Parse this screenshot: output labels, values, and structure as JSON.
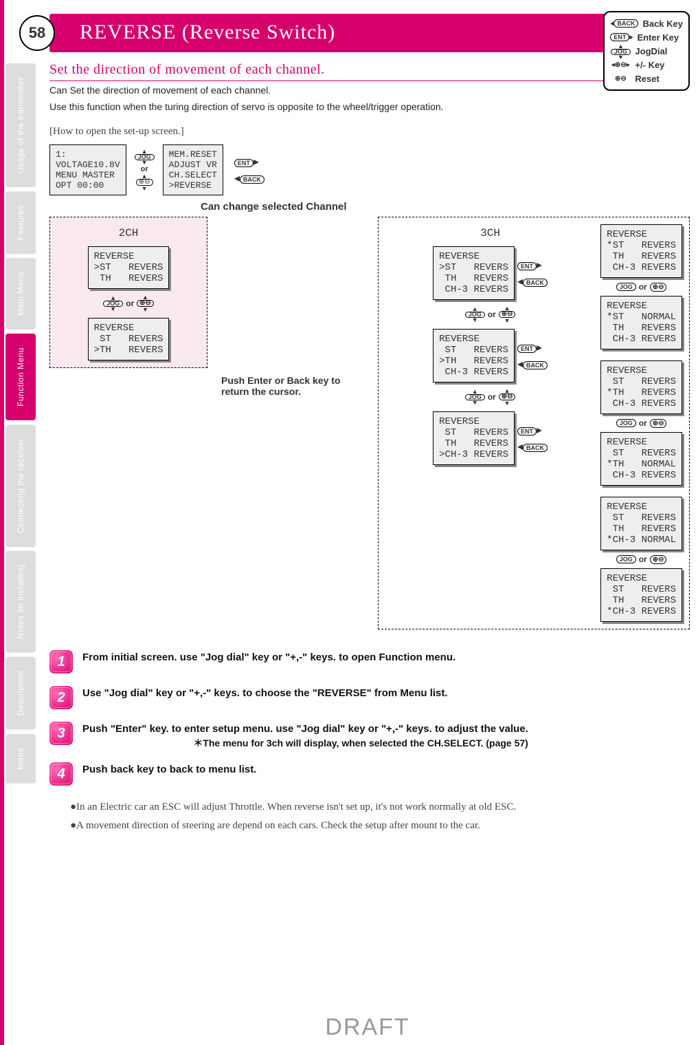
{
  "page_number": "58",
  "title": "REVERSE (Reverse Switch)",
  "subtitle": "Set the direction of movement of each channel.",
  "intro_lines": [
    "Can Set the direction of movement of each channel.",
    "Use this function when the turing direction of servo is opposite to the wheel/trigger operation."
  ],
  "howto_heading": "[How to open the set-up screen.]",
  "legend": {
    "back": "Back Key",
    "enter": "Enter Key",
    "jog": "JogDial",
    "plusminus": "+/- Key",
    "reset": "Reset"
  },
  "tabs": [
    {
      "label": "Usage of the\ntransmitter",
      "active": false
    },
    {
      "label": "Features",
      "active": false
    },
    {
      "label": "Main Menu",
      "active": false
    },
    {
      "label": "Function Menu",
      "active": true
    },
    {
      "label": "Connecting\nthe receiver",
      "active": false
    },
    {
      "label": "Notes on\ninstalling",
      "active": false
    },
    {
      "label": "Description",
      "active": false
    },
    {
      "label": "Index",
      "active": false
    }
  ],
  "lcd_initial": "1:\nVOLTAGE10.8V\nMENU MASTER\nOPT 00:00",
  "lcd_menu": "MEM.RESET\nADJUST VR\nCH.SELECT\n>REVERSE",
  "or_label": "or",
  "jog_label": "JOG",
  "ent_label": "ENT",
  "back_label": "BACK",
  "change_channel_label": "Can change selected Channel",
  "two_ch": {
    "title": "2CH",
    "screen_a": "REVERSE\n>ST   REVERS\n TH   REVERS",
    "screen_b": "REVERSE\n ST   REVERS\n>TH   REVERS",
    "hint": "Push Enter or Back key to return the cursor."
  },
  "three_ch": {
    "title": "3CH",
    "left": [
      "REVERSE\n>ST   REVERS\n TH   REVERS\n CH-3 REVERS",
      "REVERSE\n ST   REVERS\n>TH   REVERS\n CH-3 REVERS",
      "REVERSE\n ST   REVERS\n TH   REVERS\n>CH-3 REVERS"
    ],
    "right": [
      "REVERSE\n*ST   REVERS\n TH   REVERS\n CH-3 REVERS",
      "REVERSE\n*ST   NORMAL\n TH   REVERS\n CH-3 REVERS",
      "REVERSE\n ST   REVERS\n*TH   REVERS\n CH-3 REVERS",
      "REVERSE\n ST   REVERS\n*TH   NORMAL\n CH-3 REVERS",
      "REVERSE\n ST   REVERS\n TH   REVERS\n*CH-3 NORMAL",
      "REVERSE\n ST   REVERS\n TH   REVERS\n*CH-3 REVERS"
    ]
  },
  "steps": [
    {
      "n": "1",
      "text": "From initial screen. use \"Jog dial\" key or \"+,-\" keys. to open Function menu."
    },
    {
      "n": "2",
      "text": "Use \"Jog dial\" key or \"+,-\" keys. to choose the \"REVERSE\" from Menu list."
    },
    {
      "n": "3",
      "text": "Push \"Enter\" key. to enter setup menu. use \"Jog dial\" key or \"+,-\" keys. to adjust the value.",
      "sub": "＊The menu for 3ch will display, when selected the CH.SELECT. (page 57)"
    },
    {
      "n": "4",
      "text": "Push back key to back to menu list."
    }
  ],
  "notes": [
    "●In an Electric car an ESC will adjust Throttle. When reverse isn't set up, it's not work normally at old ESC.",
    "●A movement direction of steering are depend on each cars. Check the setup after mount to the car."
  ],
  "draft": "DRAFT"
}
